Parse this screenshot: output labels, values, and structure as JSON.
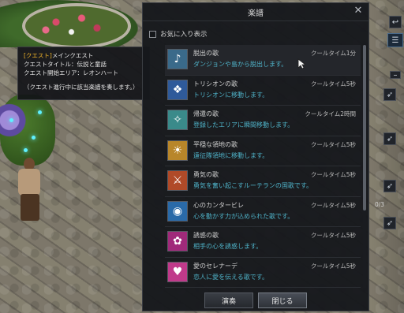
{
  "tooltip": {
    "line1_tag": "[クエスト]",
    "line1_text": "メインクエスト",
    "line2": "クエストタイトル：伝説と童話",
    "line3": "クエスト開始エリア：レオンハート",
    "line4": "（クエスト進行中に該当楽譜を奏します。）"
  },
  "dialog": {
    "title": "楽譜",
    "favorites_label": "お気に入り表示",
    "songs": [
      {
        "name": "脱出の歌",
        "desc": "ダンジョンや島から脱出します。",
        "cooldown": "クールタイム1分",
        "icon": "escape-icon",
        "color": "#3a6a8a"
      },
      {
        "name": "トリシオンの歌",
        "desc": "トリシオンに移動します。",
        "cooldown": "クールタイム5秒",
        "icon": "trixion-icon",
        "color": "#2f5a9a"
      },
      {
        "name": "帰還の歌",
        "desc": "登録したエリアに瞬間移動します。",
        "cooldown": "クールタイム2時間",
        "icon": "return-icon",
        "color": "#3a8a8a"
      },
      {
        "name": "平穏な領地の歌",
        "desc": "遠征隊領地に移動します。",
        "cooldown": "クールタイム5秒",
        "icon": "stronghold-icon",
        "color": "#b8862a"
      },
      {
        "name": "勇気の歌",
        "desc": "勇気を奮い起こすルーテランの国歌です。",
        "cooldown": "クールタイム5秒",
        "icon": "courage-icon",
        "color": "#b04a28"
      },
      {
        "name": "心のカンタービレ",
        "desc": "心を動かす力が込められた歌です。",
        "cooldown": "クールタイム5秒",
        "icon": "heart-icon",
        "color": "#2a6aa8"
      },
      {
        "name": "誘惑の歌",
        "desc": "相手の心を誘惑します。",
        "cooldown": "クールタイム5秒",
        "icon": "temptation-icon",
        "color": "#a02a7a"
      },
      {
        "name": "愛のセレナーデ",
        "desc": "恋人に愛を伝える歌です。",
        "cooldown": "クールタイム5秒",
        "icon": "love-icon",
        "color": "#c03a8a"
      }
    ],
    "play_label": "演奏",
    "close_label": "閉じる"
  },
  "hud": {
    "quest_count": "0/3"
  }
}
